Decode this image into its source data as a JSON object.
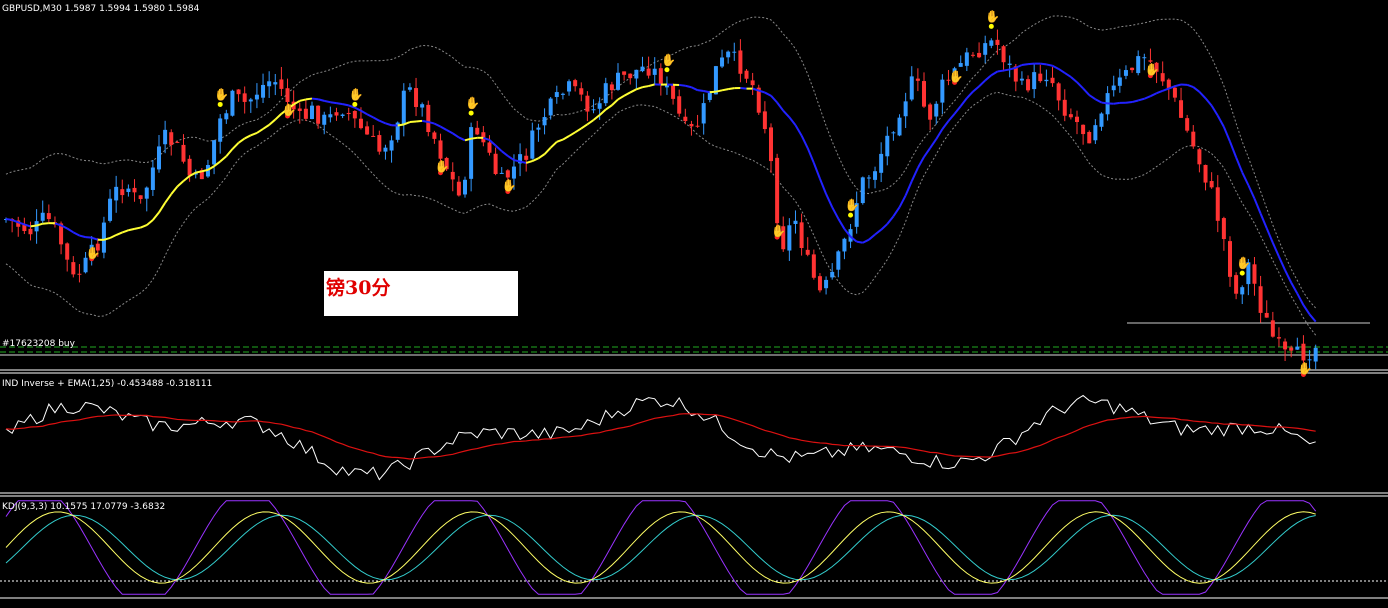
{
  "main_header": "GBPUSD,M30  1.5987 1.5994 1.5980 1.5984",
  "order_label": "#17623208 buy",
  "inverse_header": "IND Inverse + EMA(1,25) -0.453488 -0.318111",
  "kdj_header": "KDJ(9,3,3) 10.1575 17.0779 -3.6832",
  "annotation_text": "镑30分",
  "colors": {
    "background": "#000000",
    "bull_candle": "#3399ff",
    "bear_candle": "#ff3333",
    "ma_rising": "#ffff33",
    "ma_falling": "#2222ff",
    "bands": "#888888",
    "inverse_line": "#ffffff",
    "inverse_ema": "#dd1111",
    "k_line": "#ffff66",
    "d_line": "#33cccc",
    "j_line": "#9933ff",
    "order_line": "#22aa22",
    "panel_separator": "#ffffff"
  },
  "chart_data": [
    {
      "type": "candlestick",
      "title": "GBPUSD,M30",
      "last_quote": {
        "open": 1.5987,
        "high": 1.5994,
        "low": 1.598,
        "close": 1.5984
      },
      "order": {
        "id": "#17623208",
        "side": "buy"
      },
      "price_path": [
        56,
        58,
        60,
        55,
        62,
        75,
        70,
        62,
        48,
        45,
        52,
        40,
        30,
        35,
        45,
        40,
        25,
        18,
        20,
        15,
        12,
        18,
        25,
        22,
        26,
        20,
        25,
        30,
        35,
        28,
        15,
        20,
        30,
        40,
        50,
        25,
        35,
        45,
        40,
        35,
        25,
        20,
        15,
        18,
        22,
        15,
        12,
        10,
        8,
        12,
        20,
        30,
        25,
        10,
        5,
        8,
        15,
        30,
        65,
        55,
        70,
        80,
        72,
        60,
        45,
        40,
        30,
        20,
        12,
        25,
        15,
        10,
        5,
        2,
        0,
        8,
        15,
        12,
        10,
        20,
        25,
        30,
        20,
        15,
        10,
        5,
        8,
        15,
        25,
        35,
        45,
        60,
        80,
        70,
        85,
        95,
        100,
        98,
        96
      ]
    },
    {
      "type": "line",
      "title": "IND Inverse + EMA(1,25)",
      "series": [
        {
          "values": [
            -0.453488
          ]
        },
        {
          "values": [
            -0.318111
          ]
        }
      ]
    },
    {
      "type": "line",
      "title": "KDJ(9,3,3)",
      "series": [
        {
          "values": [
            10.1575
          ]
        },
        {
          "values": [
            17.0779
          ]
        },
        {
          "values": [
            -3.6832
          ]
        }
      ]
    }
  ]
}
